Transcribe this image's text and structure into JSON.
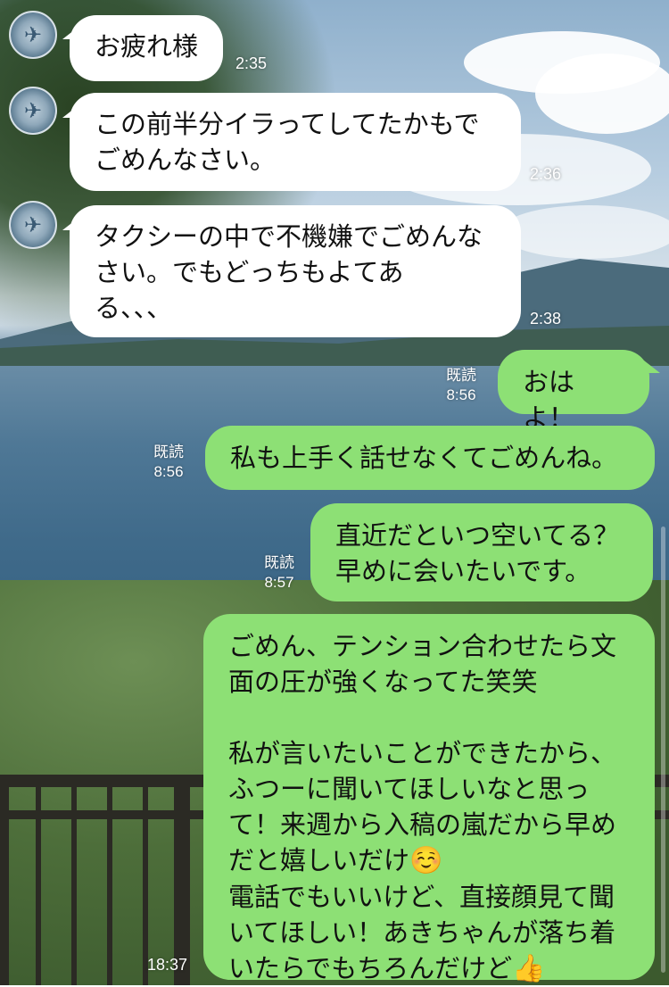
{
  "messages": [
    {
      "text": "お疲れ様",
      "time": "2:35"
    },
    {
      "text": "この前半分イラってしてたかもで\nごめんなさい。",
      "time": "2:36"
    },
    {
      "text": "タクシーの中で不機嫌でごめんな\nさい。でもどっちもよてあ\nる、、、",
      "time": "2:38"
    },
    {
      "text": "おはよ！",
      "read": "既読",
      "time": "8:56"
    },
    {
      "text": "私も上手く話せなくてごめんね。",
      "read": "既読",
      "time": "8:56"
    },
    {
      "text": "直近だといつ空いてる？\n早めに会いたいです。",
      "read": "既読",
      "time": "8:57"
    },
    {
      "text": "ごめん、テンション合わせたら文\n面の圧が強くなってた笑笑\n\n私が言いたいことができたから、\nふつーに聞いてほしいなと思っ\nて！来週から入稿の嵐だから早め\nだと嬉しいだけ",
      "text_after_emoji": "\n電話でもいいけど、直接顔見て聞\nいてほしい！あきちゃんが落ち着\nいたらでもちろんだけど",
      "time": "18:37"
    }
  ],
  "icons": {
    "smile": "☺️",
    "thumbs": "👍"
  },
  "colors": {
    "incoming": "#ffffff",
    "outgoing": "#8de075"
  }
}
